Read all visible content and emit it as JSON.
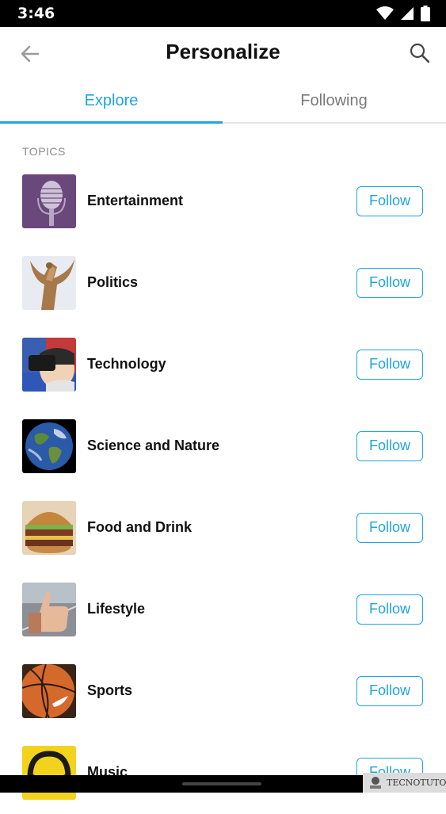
{
  "status_bar": {
    "time": "3:46"
  },
  "header": {
    "title": "Personalize"
  },
  "tabs": [
    {
      "label": "Explore",
      "active": true
    },
    {
      "label": "Following",
      "active": false
    }
  ],
  "section": {
    "label": "TOPICS"
  },
  "topics": [
    {
      "name": "Entertainment",
      "button": "Follow",
      "image": "microphone"
    },
    {
      "name": "Politics",
      "button": "Follow",
      "image": "statue"
    },
    {
      "name": "Technology",
      "button": "Follow",
      "image": "vr-headset"
    },
    {
      "name": "Science and Nature",
      "button": "Follow",
      "image": "earth"
    },
    {
      "name": "Food and Drink",
      "button": "Follow",
      "image": "burger"
    },
    {
      "name": "Lifestyle",
      "button": "Follow",
      "image": "thumbs-up"
    },
    {
      "name": "Sports",
      "button": "Follow",
      "image": "basketball"
    },
    {
      "name": "Music",
      "button": "Follow",
      "image": "headphones"
    }
  ],
  "watermark": {
    "text": "TECNOTUTO"
  },
  "colors": {
    "accent": "#1fa4e0",
    "text": "#111111",
    "muted": "#7a7a7a"
  }
}
